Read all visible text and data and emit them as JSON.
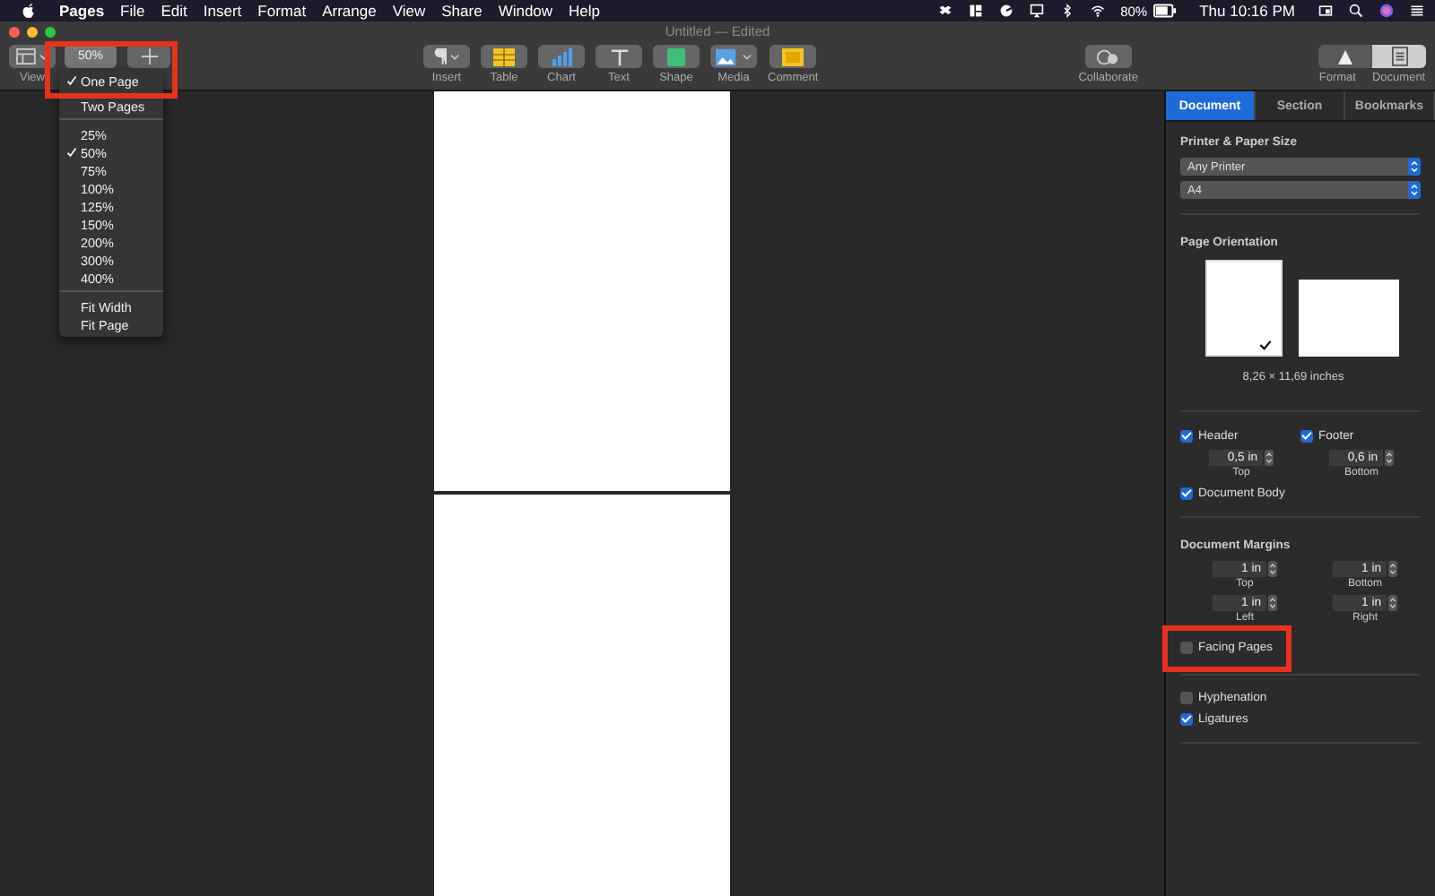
{
  "menu_bar": {
    "app": "Pages",
    "items": [
      "File",
      "Edit",
      "Insert",
      "Format",
      "Arrange",
      "View",
      "Share",
      "Window",
      "Help"
    ],
    "battery": "80%",
    "clock": "Thu 10:16 PM"
  },
  "window": {
    "title": "Untitled — Edited"
  },
  "toolbar": {
    "view_label": "View",
    "zoom": "50%",
    "tools": [
      {
        "label": "Insert",
        "kind": "insert"
      },
      {
        "label": "Table",
        "kind": "table"
      },
      {
        "label": "Chart",
        "kind": "chart"
      },
      {
        "label": "Text",
        "kind": "text"
      },
      {
        "label": "Shape",
        "kind": "shape"
      },
      {
        "label": "Media",
        "kind": "media"
      },
      {
        "label": "Comment",
        "kind": "comment"
      }
    ],
    "collaborate": "Collaborate",
    "inspectors": [
      {
        "label": "Format",
        "kind": "format",
        "selected": false
      },
      {
        "label": "Document",
        "kind": "document",
        "selected": true
      }
    ]
  },
  "zoom_menu": {
    "sections": [
      [
        {
          "label": "One Page",
          "checked": true
        },
        {
          "label": "Two Pages",
          "checked": false
        }
      ],
      [
        {
          "label": "25%",
          "checked": false
        },
        {
          "label": "50%",
          "checked": true
        },
        {
          "label": "75%",
          "checked": false
        },
        {
          "label": "100%",
          "checked": false
        },
        {
          "label": "125%",
          "checked": false
        },
        {
          "label": "150%",
          "checked": false
        },
        {
          "label": "200%",
          "checked": false
        },
        {
          "label": "300%",
          "checked": false
        },
        {
          "label": "400%",
          "checked": false
        }
      ],
      [
        {
          "label": "Fit Width",
          "checked": false
        },
        {
          "label": "Fit Page",
          "checked": false
        }
      ]
    ]
  },
  "inspector": {
    "tabs": [
      {
        "label": "Document",
        "selected": true
      },
      {
        "label": "Section",
        "selected": false
      },
      {
        "label": "Bookmarks",
        "selected": false
      }
    ],
    "printer_heading": "Printer & Paper Size",
    "printer": "Any Printer",
    "paper": "A4",
    "orientation_heading": "Page Orientation",
    "orientations": [
      {
        "kind": "portrait",
        "selected": true
      },
      {
        "kind": "landscape",
        "selected": false
      }
    ],
    "dimensions": "8,26 × 11,69 inches",
    "header": {
      "label": "Header",
      "checked": true,
      "value": "0,5 in",
      "caption": "Top"
    },
    "footer": {
      "label": "Footer",
      "checked": true,
      "value": "0,6 in",
      "caption": "Bottom"
    },
    "document_body": {
      "label": "Document Body",
      "checked": true
    },
    "margins_heading": "Document Margins",
    "margins": [
      {
        "value": "1 in",
        "caption": "Top"
      },
      {
        "value": "1 in",
        "caption": "Bottom"
      },
      {
        "value": "1 in",
        "caption": "Left"
      },
      {
        "value": "1 in",
        "caption": "Right"
      }
    ],
    "facing_pages": {
      "label": "Facing Pages",
      "checked": false
    },
    "hyphenation": {
      "label": "Hyphenation",
      "checked": false
    },
    "ligatures": {
      "label": "Ligatures",
      "checked": true
    }
  }
}
